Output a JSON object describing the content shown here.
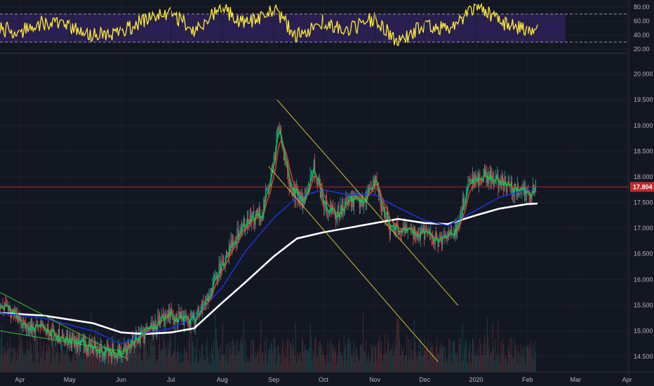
{
  "chart_data": [
    {
      "type": "line",
      "panel": "oscillator",
      "y_ticks": [
        20,
        40,
        60,
        80
      ],
      "y_tick_labels": [
        "20.00",
        "40.00",
        "60.00",
        "80.00"
      ],
      "ylim": [
        15,
        87
      ],
      "band": [
        30,
        70
      ],
      "colors": {
        "line": "#ffeb3b",
        "band_fill": "#2a1f52",
        "band_line": "#9598a1"
      },
      "x": [
        "2019-03-20",
        "2019-04-01",
        "2019-04-15",
        "2019-05-01",
        "2019-05-15",
        "2019-06-01",
        "2019-06-15",
        "2019-07-01",
        "2019-07-15",
        "2019-08-01",
        "2019-08-15",
        "2019-09-01",
        "2019-09-15",
        "2019-10-01",
        "2019-10-15",
        "2019-11-01",
        "2019-11-15",
        "2019-12-01",
        "2019-12-15",
        "2020-01-01",
        "2020-01-15",
        "2020-02-01",
        "2020-02-07"
      ],
      "values": [
        50,
        45,
        58,
        52,
        40,
        43,
        62,
        70,
        48,
        78,
        55,
        78,
        38,
        60,
        45,
        65,
        30,
        55,
        48,
        82,
        60,
        45,
        55
      ]
    },
    {
      "type": "candlestick",
      "panel": "price",
      "current_price": 17.804,
      "current_price_label": "17.804",
      "y_ticks": [
        14.5,
        15,
        15.5,
        16,
        16.5,
        17,
        17.5,
        18,
        18.5,
        19,
        19.5,
        20
      ],
      "y_tick_labels": [
        "14.500",
        "15.000",
        "15.500",
        "16.000",
        "16.500",
        "17.000",
        "17.500",
        "18.000",
        "18.500",
        "19.000",
        "19.500",
        "20.000"
      ],
      "ylim": [
        14.2,
        20.35
      ],
      "x_ticks": [
        "2019-04-01",
        "2019-05-01",
        "2019-06-01",
        "2019-07-01",
        "2019-08-01",
        "2019-09-01",
        "2019-10-01",
        "2019-11-01",
        "2019-12-01",
        "2020-01-01",
        "2020-02-01",
        "2020-03-01",
        "2020-04-01"
      ],
      "x_tick_labels": [
        "Apr",
        "May",
        "Jun",
        "Jul",
        "Aug",
        "Sep",
        "Oct",
        "Nov",
        "Dec",
        "2020",
        "Feb",
        "Mar",
        "Apr"
      ],
      "xlim": [
        "2019-03-20",
        "2020-04-02"
      ],
      "colors": {
        "up": "#26a69a",
        "down": "#ef5350",
        "fast_ma": "#00c853",
        "slow_ma": "#e53935",
        "mid_ma": "#1a33d8",
        "long_ma": "#ffffff",
        "price_line": "#c62828",
        "trend_yellow": "#d4c22a",
        "trend_green": "#3dbf3d"
      },
      "close": {
        "x": [
          "2019-03-20",
          "2019-04-01",
          "2019-04-15",
          "2019-05-01",
          "2019-05-15",
          "2019-06-01",
          "2019-06-15",
          "2019-07-01",
          "2019-07-15",
          "2019-07-25",
          "2019-08-05",
          "2019-08-15",
          "2019-08-25",
          "2019-09-01",
          "2019-09-04",
          "2019-09-10",
          "2019-09-20",
          "2019-09-25",
          "2019-10-01",
          "2019-10-08",
          "2019-10-15",
          "2019-10-25",
          "2019-11-01",
          "2019-11-10",
          "2019-11-20",
          "2019-12-01",
          "2019-12-10",
          "2019-12-20",
          "2019-12-28",
          "2020-01-05",
          "2020-01-15",
          "2020-01-25",
          "2020-02-01",
          "2020-02-06"
        ],
        "values": [
          15.55,
          15.2,
          15.0,
          14.85,
          14.65,
          14.6,
          14.95,
          15.3,
          15.2,
          15.8,
          16.6,
          17.1,
          17.3,
          18.3,
          19.1,
          17.8,
          17.5,
          18.2,
          17.5,
          17.2,
          17.55,
          17.5,
          17.9,
          17.0,
          16.9,
          16.9,
          16.75,
          17.0,
          17.9,
          18.05,
          17.9,
          17.75,
          17.65,
          17.8
        ]
      },
      "moving_averages": [
        {
          "role": "long",
          "x": [
            "2019-03-20",
            "2019-04-15",
            "2019-05-15",
            "2019-06-01",
            "2019-06-15",
            "2019-07-01",
            "2019-07-15",
            "2019-08-01",
            "2019-08-15",
            "2019-09-01",
            "2019-09-15",
            "2019-10-01",
            "2019-10-15",
            "2019-11-01",
            "2019-11-15",
            "2019-12-01",
            "2019-12-15",
            "2020-01-01",
            "2020-01-15",
            "2020-02-01",
            "2020-02-07"
          ],
          "values": [
            15.35,
            15.3,
            15.15,
            14.97,
            14.94,
            14.97,
            15.05,
            15.55,
            15.95,
            16.45,
            16.8,
            16.92,
            17.0,
            17.1,
            17.18,
            17.1,
            17.08,
            17.25,
            17.38,
            17.47,
            17.48
          ]
        },
        {
          "role": "mid",
          "x": [
            "2019-03-20",
            "2019-04-15",
            "2019-05-15",
            "2019-06-01",
            "2019-06-15",
            "2019-07-01",
            "2019-07-15",
            "2019-08-01",
            "2019-08-15",
            "2019-09-01",
            "2019-09-15",
            "2019-10-01",
            "2019-10-15",
            "2019-11-01",
            "2019-11-15",
            "2019-12-01",
            "2019-12-15",
            "2020-01-01",
            "2020-01-15",
            "2020-02-01",
            "2020-02-07"
          ],
          "values": [
            15.35,
            15.25,
            15.0,
            14.75,
            14.95,
            15.05,
            15.25,
            15.85,
            16.55,
            17.2,
            17.6,
            17.75,
            17.65,
            17.65,
            17.4,
            17.15,
            17.05,
            17.35,
            17.6,
            17.75,
            17.7
          ]
        }
      ],
      "trendlines": [
        {
          "role": "yellow-upper",
          "x": [
            "2019-09-03",
            "2019-12-21"
          ],
          "values": [
            19.5,
            15.5
          ]
        },
        {
          "role": "yellow-lower",
          "x": [
            "2019-08-29",
            "2019-12-09"
          ],
          "values": [
            18.2,
            14.4
          ]
        },
        {
          "role": "green-upper",
          "x": [
            "2019-03-20",
            "2019-06-05"
          ],
          "values": [
            15.75,
            14.45
          ]
        },
        {
          "role": "green-lower",
          "x": [
            "2019-03-20",
            "2019-06-03"
          ],
          "values": [
            15.0,
            14.6
          ]
        }
      ]
    }
  ]
}
